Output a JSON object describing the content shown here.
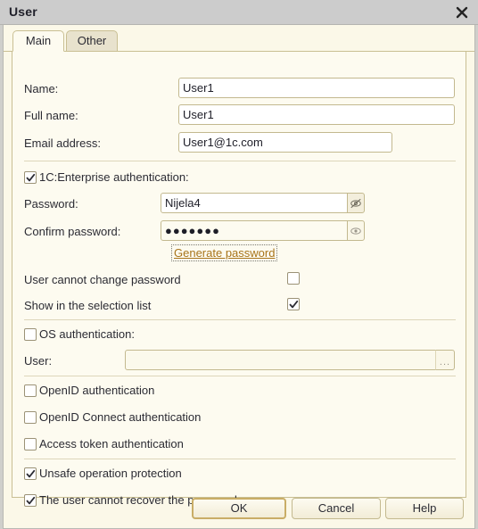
{
  "window": {
    "title": "User",
    "close_icon": "close-icon"
  },
  "tabs": [
    {
      "label": "Main",
      "active": true
    },
    {
      "label": "Other",
      "active": false
    }
  ],
  "fields": {
    "name": {
      "label": "Name:",
      "value": "User1",
      "placeholder": ""
    },
    "full_name": {
      "label": "Full name:",
      "value": "User1",
      "placeholder": ""
    },
    "email": {
      "label": "Email address:",
      "value": "User1@1c.com",
      "placeholder": ""
    },
    "password": {
      "label": "Password:",
      "value": "Nijela4",
      "reveal_icon": "eye-slash-icon"
    },
    "confirm_password": {
      "label": "Confirm password:",
      "value": "●●●●●●●",
      "reveal_icon": "eye-icon"
    },
    "os_user": {
      "label": "User:",
      "value": "",
      "placeholder": "",
      "picker_label": "..."
    }
  },
  "links": {
    "generate_password": "Generate password"
  },
  "checkboxes": {
    "enterprise_auth": {
      "label": "1C:Enterprise authentication:",
      "checked": true
    },
    "cannot_change_password": {
      "label": "User cannot change password",
      "checked": false
    },
    "show_in_selection_list": {
      "label": "Show in the selection list",
      "checked": true
    },
    "os_auth": {
      "label": "OS authentication:",
      "checked": false
    },
    "openid_auth": {
      "label": "OpenID authentication",
      "checked": false
    },
    "openid_connect_auth": {
      "label": "OpenID Connect authentication",
      "checked": false
    },
    "access_token_auth": {
      "label": "Access token authentication",
      "checked": false
    },
    "unsafe_operation_protection": {
      "label": "Unsafe operation protection",
      "checked": true
    },
    "cannot_recover_password": {
      "label": "The user cannot recover the password",
      "checked": true
    }
  },
  "buttons": {
    "ok": "OK",
    "cancel": "Cancel",
    "help": "Help"
  },
  "colors": {
    "titlebar": "#cccccc",
    "panel": "#fdfbf0",
    "dialog": "#fbf8e8",
    "border": "#c9bf93",
    "link": "#a8741a",
    "default_button_border": "#c9ad66"
  }
}
